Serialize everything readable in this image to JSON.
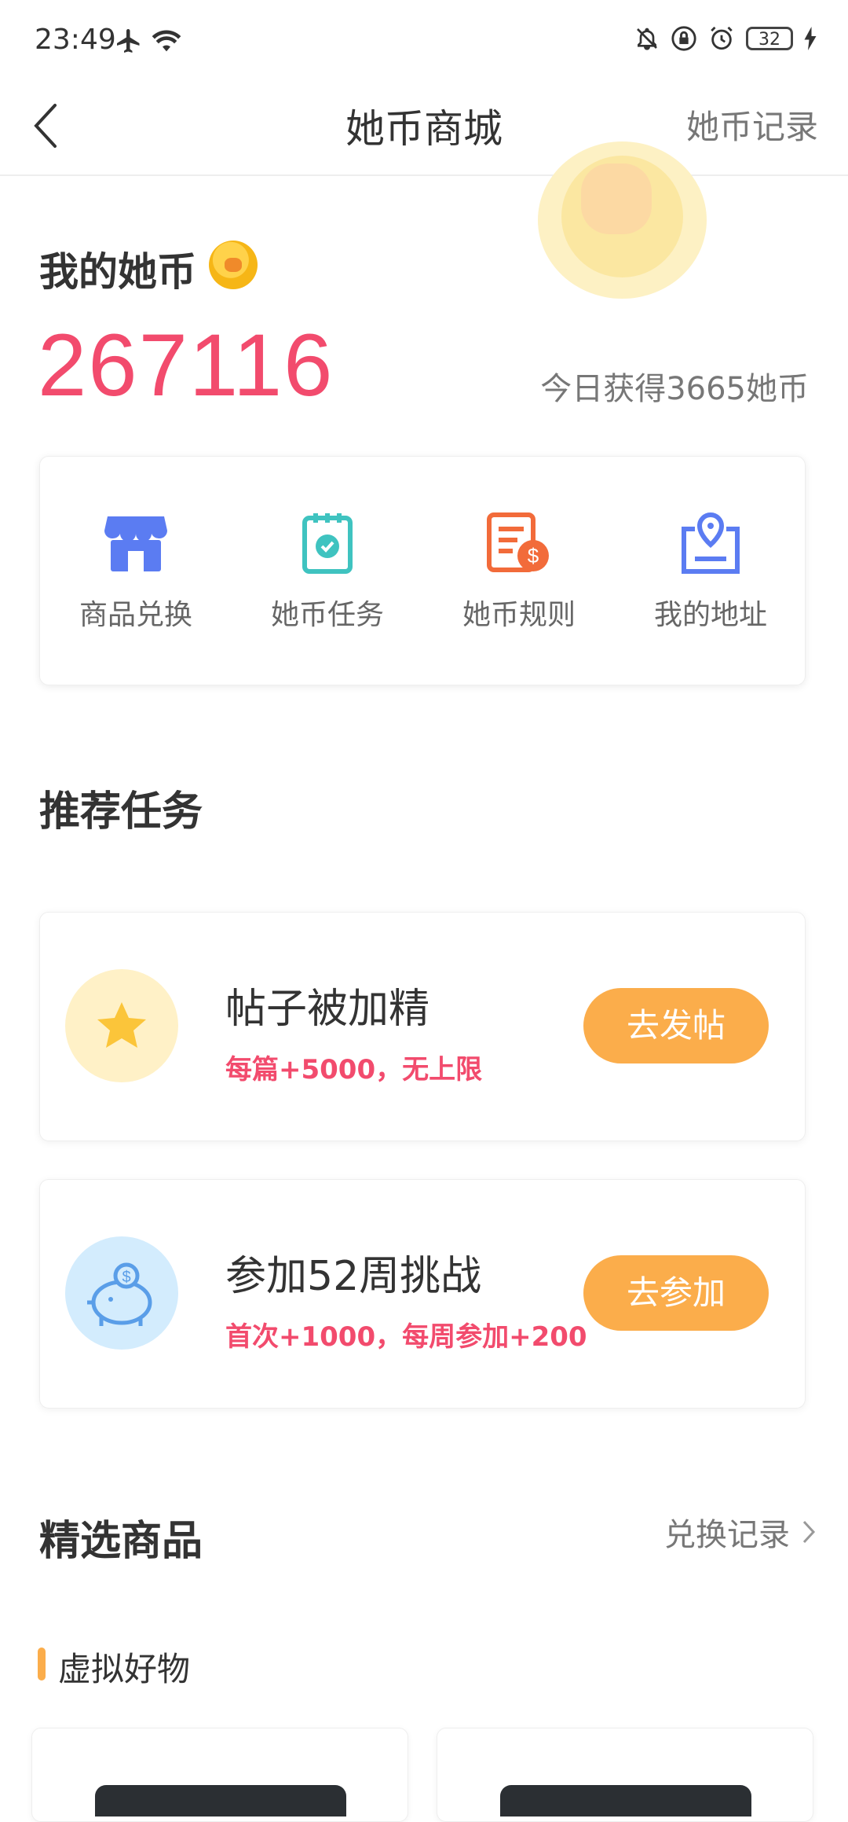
{
  "status_bar": {
    "time": "23:49",
    "battery": "32"
  },
  "header": {
    "title": "她币商城",
    "record_link": "她币记录"
  },
  "wallet": {
    "title": "我的她币",
    "balance": "267116",
    "today_earned": "今日获得3665她币"
  },
  "menu": {
    "items": [
      {
        "label": "商品兑换",
        "icon": "store-icon",
        "color": "#5b7cf2"
      },
      {
        "label": "她币任务",
        "icon": "task-clipboard-icon",
        "color": "#3fc3c0"
      },
      {
        "label": "她币规则",
        "icon": "rules-document-icon",
        "color": "#f26b3a"
      },
      {
        "label": "我的地址",
        "icon": "address-location-icon",
        "color": "#5b7cf2"
      }
    ]
  },
  "recommended": {
    "title": "推荐任务",
    "tasks": [
      {
        "name": "帖子被加精",
        "reward": "每篇+5000，无上限",
        "button": "去发帖",
        "icon": "star-icon",
        "icon_bg": "#fff1c7",
        "icon_color": "#fbc53a"
      },
      {
        "name": "参加52周挑战",
        "reward": "首次+1000，每周参加+200",
        "button": "去参加",
        "icon": "piggy-bank-icon",
        "icon_bg": "#d3ecfd",
        "icon_color": "#5a9ee8"
      }
    ]
  },
  "products": {
    "title": "精选商品",
    "exchange_link": "兑换记录",
    "category": "虚拟好物"
  },
  "colors": {
    "accent": "#f24b6d",
    "button": "#fbad4b"
  }
}
